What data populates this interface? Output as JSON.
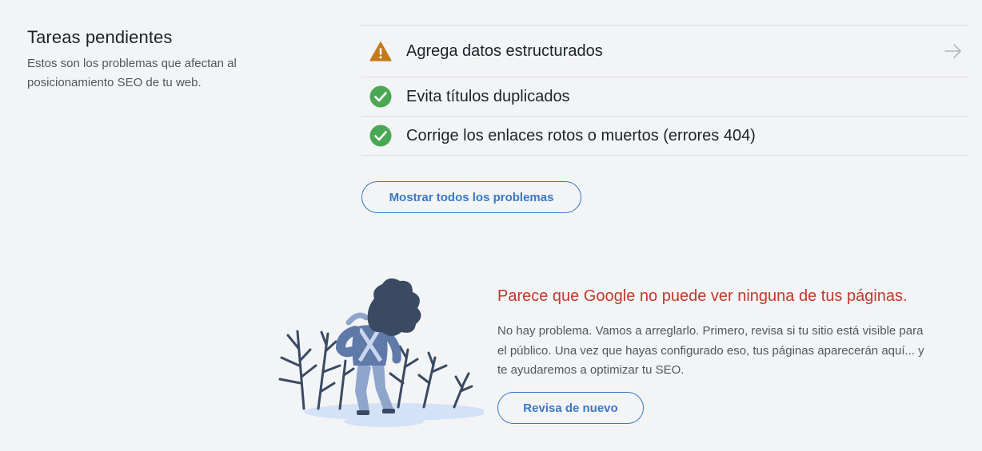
{
  "pending": {
    "title": "Tareas pendientes",
    "description": "Estos son los problemas que afectan al posicionamiento SEO de tu web."
  },
  "tasks": [
    {
      "label": "Agrega datos estructurados",
      "status": "warning",
      "icon": "warning-icon"
    },
    {
      "label": "Evita títulos duplicados",
      "status": "done",
      "icon": "check-circle-icon"
    },
    {
      "label": "Corrige los enlaces rotos o muertos (errores 404)",
      "status": "done",
      "icon": "check-circle-icon"
    }
  ],
  "show_all_button": "Mostrar todos los problemas",
  "notice": {
    "heading": "Parece que Google no puede ver ninguna de tus páginas.",
    "body": "No hay problema. Vamos a arreglarlo. Primero, revisa si tu sitio está visible para el público. Una vez que hayas configurado eso, tus páginas aparecerán aquí... y te ayudaremos a optimizar tu SEO.",
    "recheck_button": "Revisa de nuevo"
  },
  "colors": {
    "warning": "#c27a1b",
    "success": "#4aa855",
    "link": "#3a78c4",
    "error_heading": "#c0392b"
  }
}
